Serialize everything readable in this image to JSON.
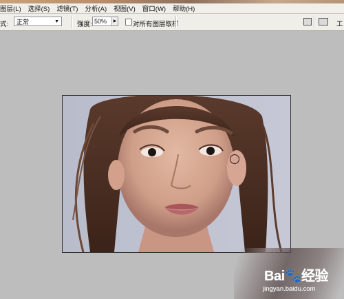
{
  "menubar": {
    "items": [
      {
        "label": "图层(L)"
      },
      {
        "label": "选择(S)"
      },
      {
        "label": "滤镜(T)"
      },
      {
        "label": "分析(A)"
      },
      {
        "label": "视图(V)"
      },
      {
        "label": "窗口(W)"
      },
      {
        "label": "帮助(H)"
      }
    ]
  },
  "options": {
    "mode_label": "式:",
    "mode_value": "正常",
    "strength_label": "强度:",
    "strength_value": "50%",
    "sample_all_label": "对所有图层取样",
    "workspace_label": "工"
  },
  "watermark": {
    "brand": "Bai",
    "brand_suffix": "经验",
    "url": "jingyan.baidu.com"
  },
  "colors": {
    "canvas_bg": "#bdbdbd",
    "menubar_bg": "#f0efea"
  }
}
